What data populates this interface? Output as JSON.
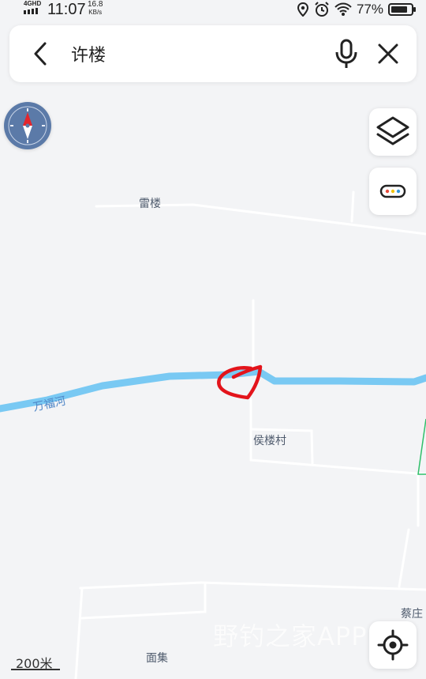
{
  "status_bar": {
    "network": "4GHD",
    "time": "11:07",
    "speed_value": "16.8",
    "speed_unit": "KB/s",
    "battery_percent": "77%",
    "icons": [
      "signal-icon",
      "location-icon",
      "alarm-icon",
      "wifi-icon",
      "battery-icon"
    ]
  },
  "search": {
    "query": "许楼",
    "icons": {
      "back": "back-arrow-icon",
      "voice": "microphone-icon",
      "clear": "close-icon"
    }
  },
  "controls": {
    "compass": "compass-icon",
    "layers": "layers-icon",
    "more": "more-dots-icon",
    "locate": "locate-icon"
  },
  "map": {
    "labels": {
      "village_north": "雷楼",
      "river": "万福河",
      "village_center": "侯楼村",
      "village_east": "蔡庄",
      "village_south": "面集"
    },
    "scale": "200米",
    "colors": {
      "background": "#f3f4f6",
      "river": "#79c9f3",
      "road": "#ffffff",
      "annotation": "#e3141b",
      "boundary": "#2fbf6a"
    }
  },
  "watermark": "野钓之家APP"
}
